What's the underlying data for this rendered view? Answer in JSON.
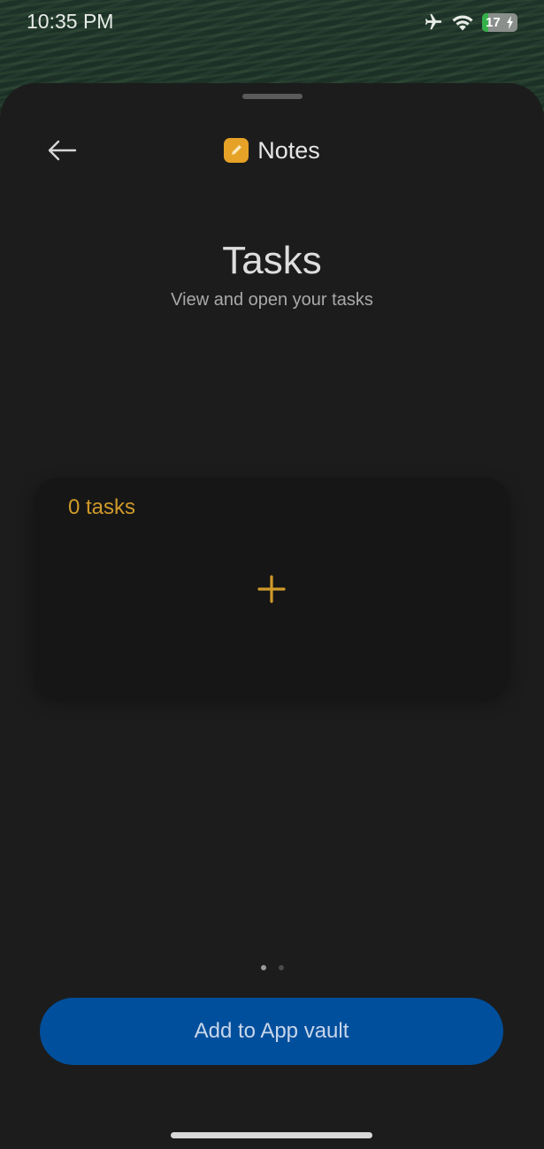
{
  "status_bar": {
    "time": "10:35 PM",
    "battery_level": "17",
    "battery_percent": 0.17,
    "icons": [
      "airplane-mode-icon",
      "wifi-icon",
      "battery-charging-icon"
    ]
  },
  "header": {
    "back_icon": "arrow-left-icon",
    "app_icon": "notes-pencil-icon",
    "app_name": "Notes"
  },
  "widget_preview": {
    "title": "Tasks",
    "subtitle": "View and open your tasks",
    "card": {
      "count_label": "0 tasks",
      "add_icon": "plus-icon"
    }
  },
  "pagination": {
    "total": 2,
    "active_index": 0
  },
  "primary_action": {
    "label": "Add to App vault"
  },
  "colors": {
    "sheet_background": "#1c1c1c",
    "card_background": "#161616",
    "accent_yellow": "#d09a2a",
    "app_icon_background": "#e5a227",
    "button_blue": "#004f9c"
  }
}
